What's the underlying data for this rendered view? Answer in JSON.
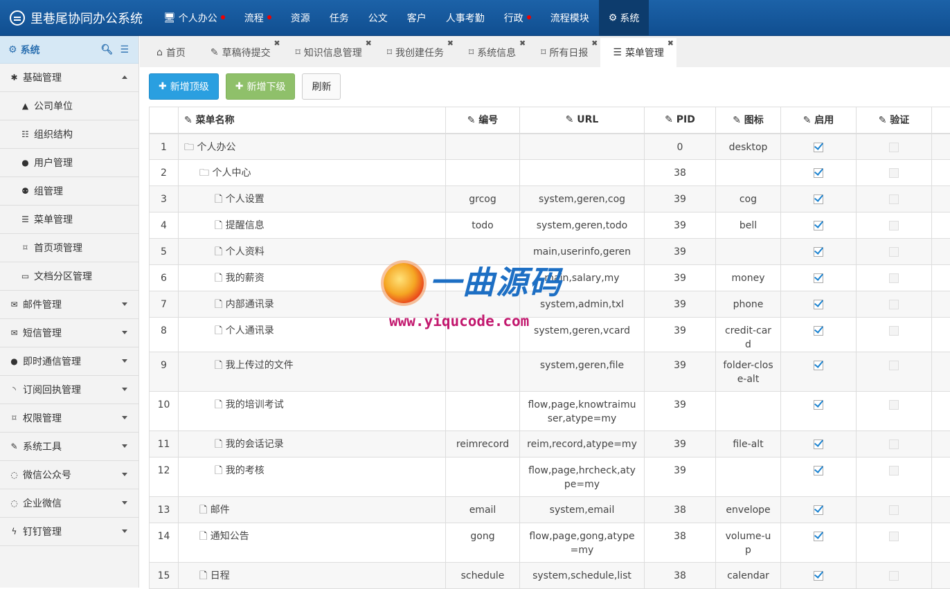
{
  "app": {
    "title": "里巷尾协同办公系统"
  },
  "topnav": [
    {
      "label": "个人办公",
      "icon": "monitor-icon",
      "dot": true,
      "active": false
    },
    {
      "label": "流程",
      "icon": "",
      "dot": true,
      "active": false
    },
    {
      "label": "资源",
      "icon": "",
      "dot": false,
      "active": false
    },
    {
      "label": "任务",
      "icon": "",
      "dot": false,
      "active": false
    },
    {
      "label": "公文",
      "icon": "",
      "dot": false,
      "active": false
    },
    {
      "label": "客户",
      "icon": "",
      "dot": false,
      "active": false
    },
    {
      "label": "人事考勤",
      "icon": "",
      "dot": false,
      "active": false
    },
    {
      "label": "行政",
      "icon": "",
      "dot": true,
      "active": false
    },
    {
      "label": "流程模块",
      "icon": "",
      "dot": false,
      "active": false
    },
    {
      "label": "系统",
      "icon": "gear-icon",
      "dot": false,
      "active": true
    }
  ],
  "sidebar": {
    "title": "系统",
    "groups": [
      {
        "label": "基础管理",
        "icon": "asterisk-icon",
        "expanded": true,
        "items": [
          {
            "label": "公司单位",
            "icon": "building-icon"
          },
          {
            "label": "组织结构",
            "icon": "sitemap-icon"
          },
          {
            "label": "用户管理",
            "icon": "user-icon"
          },
          {
            "label": "组管理",
            "icon": "users-icon"
          },
          {
            "label": "菜单管理",
            "icon": "list-icon"
          },
          {
            "label": "首页项管理",
            "icon": "bookmark-icon"
          },
          {
            "label": "文档分区管理",
            "icon": "folder-icon"
          }
        ]
      },
      {
        "label": "邮件管理",
        "icon": "envelope-icon",
        "expanded": false
      },
      {
        "label": "短信管理",
        "icon": "envelope-open-icon",
        "expanded": false
      },
      {
        "label": "即时通信管理",
        "icon": "comment-icon",
        "expanded": false
      },
      {
        "label": "订阅回执管理",
        "icon": "rss-icon",
        "expanded": false
      },
      {
        "label": "权限管理",
        "icon": "bookmark-icon",
        "expanded": false
      },
      {
        "label": "系统工具",
        "icon": "wrench-icon",
        "expanded": false
      },
      {
        "label": "微信公众号",
        "icon": "chat-icon",
        "expanded": false
      },
      {
        "label": "企业微信",
        "icon": "chat-icon",
        "expanded": false
      },
      {
        "label": "钉钉管理",
        "icon": "bolt-icon",
        "expanded": false
      }
    ]
  },
  "tabs": [
    {
      "label": "首页",
      "icon": "home-icon",
      "closable": false,
      "active": false
    },
    {
      "label": "草稿待提交",
      "icon": "edit-icon",
      "closable": true,
      "active": false
    },
    {
      "label": "知识信息管理",
      "icon": "bookmark-icon",
      "closable": true,
      "active": false
    },
    {
      "label": "我创建任务",
      "icon": "bookmark-icon",
      "closable": true,
      "active": false
    },
    {
      "label": "系统信息",
      "icon": "bookmark-icon",
      "closable": true,
      "active": false
    },
    {
      "label": "所有日报",
      "icon": "bookmark-icon",
      "closable": true,
      "active": false
    },
    {
      "label": "菜单管理",
      "icon": "list-icon",
      "closable": true,
      "active": true
    }
  ],
  "toolbar": {
    "add_top": "新增顶级",
    "add_sub": "新增下级",
    "refresh": "刷新"
  },
  "table": {
    "columns": [
      "菜单名称",
      "编号",
      "URL",
      "PID",
      "图标",
      "启用",
      "验证"
    ],
    "rows": [
      {
        "no": "1",
        "name": "个人办公",
        "level": 0,
        "type": "folder",
        "code": "",
        "url": "",
        "pid": "0",
        "icon": "desktop",
        "enabled": true,
        "verify": false
      },
      {
        "no": "2",
        "name": "个人中心",
        "level": 1,
        "type": "folder",
        "code": "",
        "url": "",
        "pid": "38",
        "icon": "",
        "enabled": true,
        "verify": false
      },
      {
        "no": "3",
        "name": "个人设置",
        "level": 2,
        "type": "file",
        "code": "grcog",
        "url": "system,geren,cog",
        "pid": "39",
        "icon": "cog",
        "enabled": true,
        "verify": false
      },
      {
        "no": "4",
        "name": "提醒信息",
        "level": 2,
        "type": "file",
        "code": "todo",
        "url": "system,geren,todo",
        "pid": "39",
        "icon": "bell",
        "enabled": true,
        "verify": false
      },
      {
        "no": "5",
        "name": "个人资料",
        "level": 2,
        "type": "file",
        "code": "",
        "url": "main,userinfo,geren",
        "pid": "39",
        "icon": "",
        "enabled": true,
        "verify": false
      },
      {
        "no": "6",
        "name": "我的薪资",
        "level": 2,
        "type": "file",
        "code": "",
        "url": "main,salary,my",
        "pid": "39",
        "icon": "money",
        "enabled": true,
        "verify": false
      },
      {
        "no": "7",
        "name": "内部通讯录",
        "level": 2,
        "type": "file",
        "code": "",
        "url": "system,admin,txl",
        "pid": "39",
        "icon": "phone",
        "enabled": true,
        "verify": false
      },
      {
        "no": "8",
        "name": "个人通讯录",
        "level": 2,
        "type": "file",
        "code": "",
        "url": "system,geren,vcard",
        "pid": "39",
        "icon": "credit-card",
        "enabled": true,
        "verify": false
      },
      {
        "no": "9",
        "name": "我上传过的文件",
        "level": 2,
        "type": "file",
        "code": "",
        "url": "system,geren,file",
        "pid": "39",
        "icon": "folder-close-alt",
        "enabled": true,
        "verify": false
      },
      {
        "no": "10",
        "name": "我的培训考试",
        "level": 2,
        "type": "file",
        "code": "",
        "url": "flow,page,knowtraimuser,atype=my",
        "pid": "39",
        "icon": "",
        "enabled": true,
        "verify": false
      },
      {
        "no": "11",
        "name": "我的会话记录",
        "level": 2,
        "type": "file",
        "code": "reimrecord",
        "url": "reim,record,atype=my",
        "pid": "39",
        "icon": "file-alt",
        "enabled": true,
        "verify": false
      },
      {
        "no": "12",
        "name": "我的考核",
        "level": 2,
        "type": "file",
        "code": "",
        "url": "flow,page,hrcheck,atype=my",
        "pid": "39",
        "icon": "",
        "enabled": true,
        "verify": false
      },
      {
        "no": "13",
        "name": "邮件",
        "level": 1,
        "type": "file",
        "code": "email",
        "url": "system,email",
        "pid": "38",
        "icon": "envelope",
        "enabled": true,
        "verify": false
      },
      {
        "no": "14",
        "name": "通知公告",
        "level": 1,
        "type": "file",
        "code": "gong",
        "url": "flow,page,gong,atype=my",
        "pid": "38",
        "icon": "volume-up",
        "enabled": true,
        "verify": false
      },
      {
        "no": "15",
        "name": "日程",
        "level": 1,
        "type": "file",
        "code": "schedule",
        "url": "system,schedule,list",
        "pid": "38",
        "icon": "calendar",
        "enabled": true,
        "verify": false
      }
    ]
  },
  "watermark": {
    "title": "一曲源码",
    "url": "www.yiqucode.com"
  }
}
